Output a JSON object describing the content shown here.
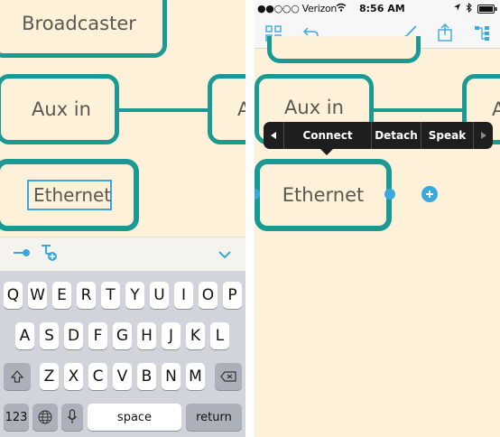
{
  "left": {
    "nodes": {
      "broadcaster": "Broadcaster",
      "aux_in": "Aux in",
      "partial": "A",
      "ethernet": "Ethernet"
    },
    "accessory": {
      "chevron_icon": "chevron-down-icon",
      "link_icon": "connect-node-icon",
      "child_icon": "add-child-node-icon"
    },
    "keyboard": {
      "row1": [
        "Q",
        "W",
        "E",
        "R",
        "T",
        "Y",
        "U",
        "I",
        "O",
        "P"
      ],
      "row2": [
        "A",
        "S",
        "D",
        "F",
        "G",
        "H",
        "J",
        "K",
        "L"
      ],
      "row3": [
        "Z",
        "X",
        "C",
        "V",
        "B",
        "N",
        "M"
      ],
      "numbers_label": "123",
      "space_label": "space",
      "return_label": "return"
    }
  },
  "right": {
    "status": {
      "carrier": "●●○○○ Verizon",
      "time": "8:56 AM"
    },
    "nodes": {
      "aux_in": "Aux in",
      "partial": "A",
      "ethernet": "Ethernet"
    },
    "context_menu": {
      "items": [
        "Connect",
        "Detach",
        "Speak"
      ]
    },
    "accent": "#1a9a92",
    "blue": "#3ba8dd"
  }
}
